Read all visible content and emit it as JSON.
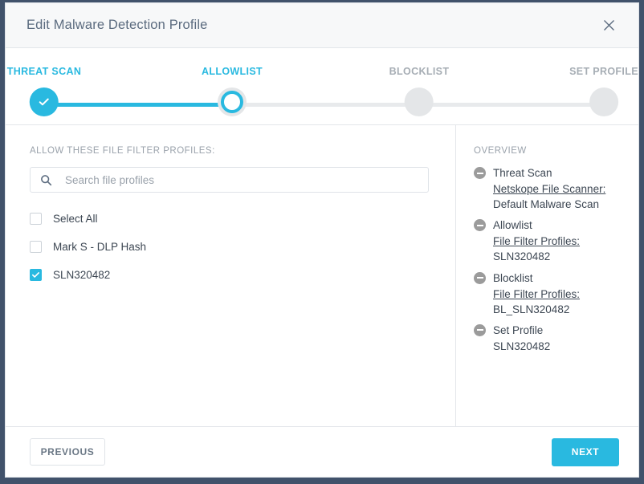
{
  "window": {
    "title": "Edit Malware Detection Profile",
    "close_icon": "close-icon"
  },
  "accent_color": "#29b9e0",
  "stepper": {
    "steps": [
      {
        "label": "THREAT SCAN",
        "state": "done"
      },
      {
        "label": "ALLOWLIST",
        "state": "active"
      },
      {
        "label": "BLOCKLIST",
        "state": "pending"
      },
      {
        "label": "SET PROFILE",
        "state": "pending"
      }
    ]
  },
  "left": {
    "section_label": "ALLOW THESE FILE FILTER PROFILES:",
    "search": {
      "icon": "search-icon",
      "placeholder": "Search file profiles",
      "value": ""
    },
    "options": [
      {
        "label": "Select All",
        "checked": false
      },
      {
        "label": "Mark S - DLP Hash",
        "checked": false
      },
      {
        "label": "SLN320482",
        "checked": true
      }
    ]
  },
  "overview": {
    "heading": "OVERVIEW",
    "groups": [
      {
        "title": "Threat Scan",
        "key": "Netskope File Scanner:",
        "value": "Default Malware Scan"
      },
      {
        "title": "Allowlist",
        "key": "File Filter Profiles:",
        "value": "SLN320482"
      },
      {
        "title": "Blocklist",
        "key": "File Filter Profiles:",
        "value": "BL_SLN320482"
      },
      {
        "title": "Set Profile",
        "key": "",
        "value": "SLN320482"
      }
    ]
  },
  "footer": {
    "previous_label": "PREVIOUS",
    "next_label": "NEXT"
  }
}
